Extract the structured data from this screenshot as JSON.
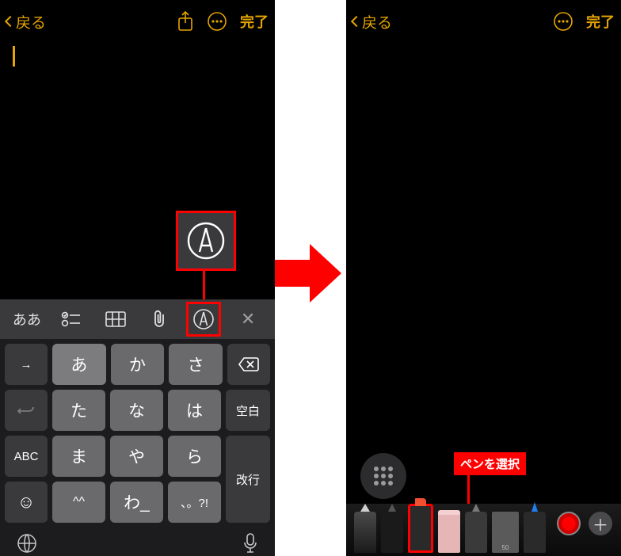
{
  "nav": {
    "back": "戻る",
    "done": "完了"
  },
  "callout_label": "ペンを選択",
  "quickbar": {
    "items": [
      "ああ",
      "list",
      "table",
      "clip",
      "markup",
      "close"
    ]
  },
  "keyboard": {
    "rows": [
      {
        "func_l": "→",
        "keys": [
          "あ",
          "か",
          "さ"
        ],
        "func_r": "del"
      },
      {
        "func_l": "↶",
        "keys": [
          "た",
          "な",
          "は"
        ],
        "func_r": "空白"
      },
      {
        "func_l": "ABC",
        "keys": [
          "ま",
          "や",
          "ら"
        ],
        "func_r": "改行"
      },
      {
        "func_l": "☺",
        "keys": [
          "^^",
          "わ_",
          "、。?!"
        ],
        "func_r": ""
      }
    ],
    "globe": "globe",
    "mic": "mic"
  },
  "tools": {
    "ruler_text": "50"
  }
}
